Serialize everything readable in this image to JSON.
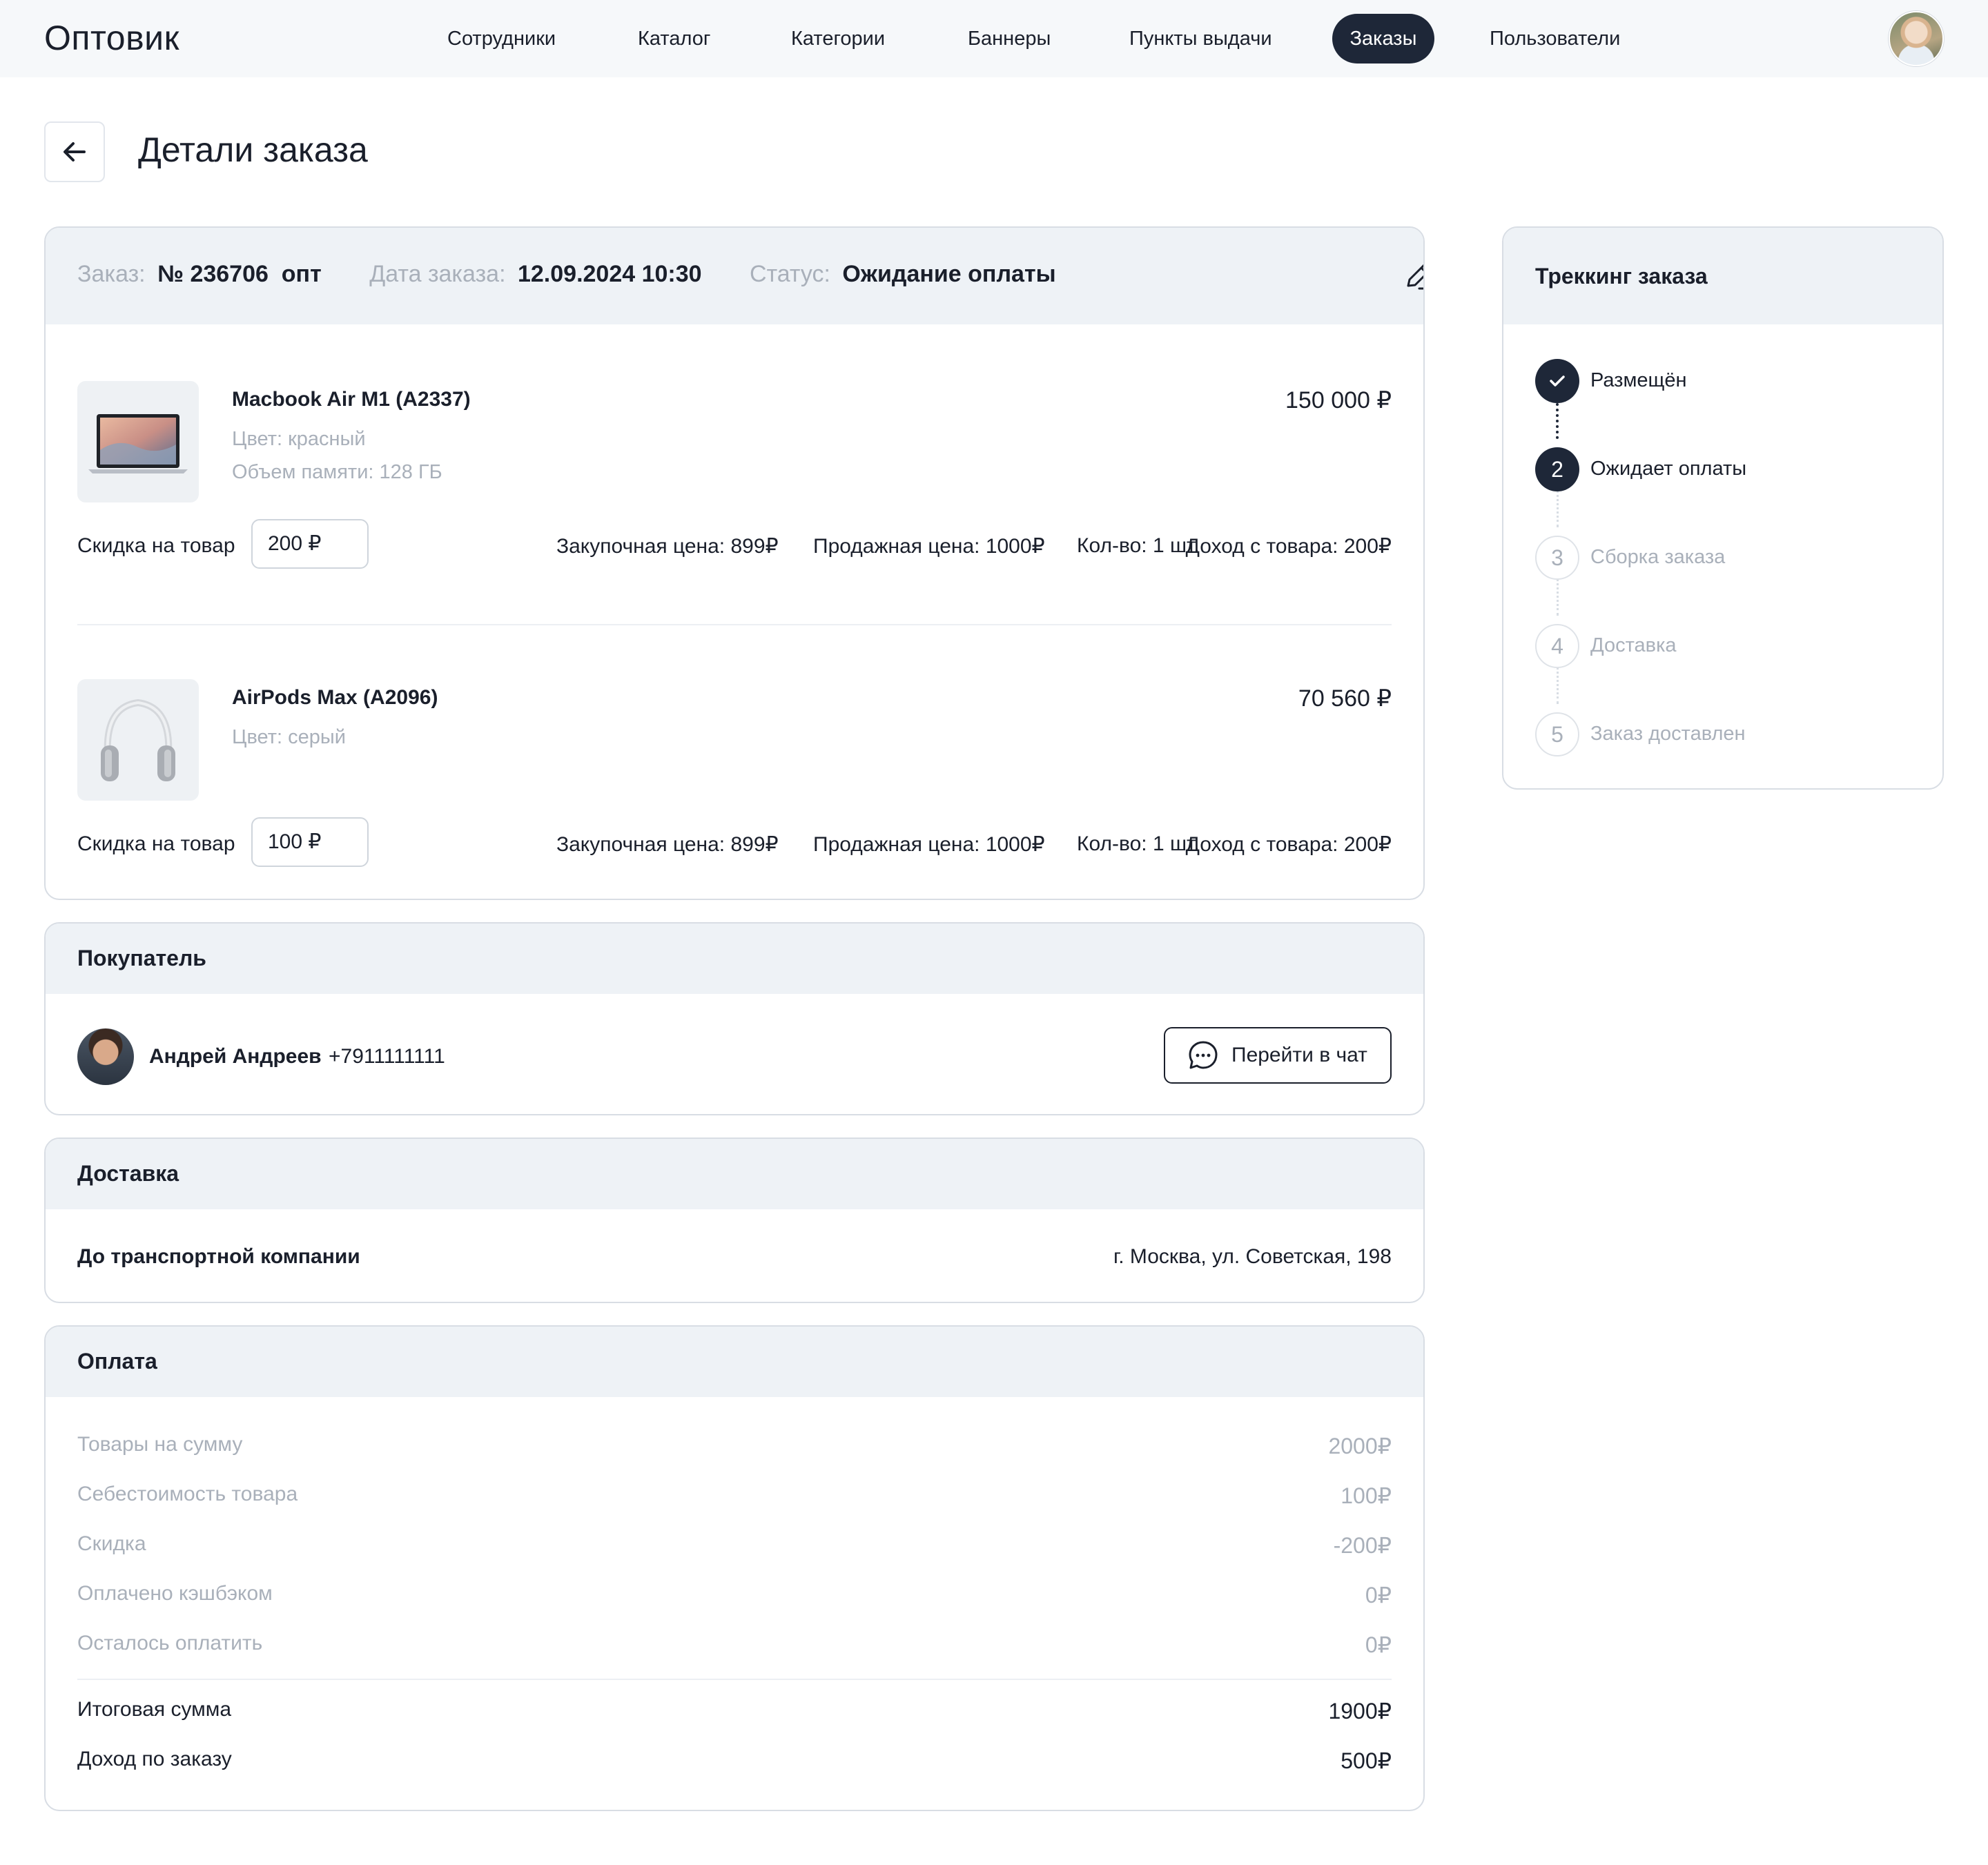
{
  "app": {
    "logo": "Оптовик",
    "nav": [
      {
        "label": "Сотрудники",
        "active": false
      },
      {
        "label": "Каталог",
        "active": false
      },
      {
        "label": "Категории",
        "active": false
      },
      {
        "label": "Баннеры",
        "active": false
      },
      {
        "label": "Пункты выдачи",
        "active": false
      },
      {
        "label": "Заказы",
        "active": true
      },
      {
        "label": "Пользователи",
        "active": false
      }
    ],
    "avatar_icon": "user-avatar"
  },
  "page": {
    "title": "Детали заказа",
    "back_icon": "arrow-left-icon"
  },
  "order": {
    "order_label": "Заказ:",
    "order_number": "№ 236706  опт",
    "date_label": "Дата заказа:",
    "date_value": "12.09.2024 10:30",
    "status_label": "Статус:",
    "status_value": "Ожидание оплаты",
    "edit_icon": "pencil-icon",
    "products": [
      {
        "name": "Macbook Air M1 (A2337)",
        "attrs": [
          "Цвет: красный",
          "Объем памяти: 128 ГБ"
        ],
        "price": "150 000 ₽",
        "discount_label": "Скидка на товар",
        "discount_value": "200 ₽",
        "purchase_price": "Закупочная цена: 899₽",
        "sale_price": "Продажная цена: 1000₽",
        "qty": "Кол-во: 1 шт.",
        "income": "Доход с товара: 200₽"
      },
      {
        "name": "AirPods Max (A2096)",
        "attrs": [
          "Цвет: серый"
        ],
        "price": "70 560 ₽",
        "discount_label": "Скидка на товар",
        "discount_value": "100 ₽",
        "purchase_price": "Закупочная цена: 899₽",
        "sale_price": "Продажная цена: 1000₽",
        "qty": "Кол-во: 1 шт.",
        "income": "Доход с товара: 200₽"
      }
    ]
  },
  "buyer": {
    "title": "Покупатель",
    "name": "Андрей Андреев",
    "phone": "+7911111111",
    "chat_button": "Перейти в чат",
    "chat_icon": "chat-bubble-icon"
  },
  "delivery": {
    "title": "Доставка",
    "method": "До транспортной компании",
    "address": "г. Москва, ул. Советская, 198"
  },
  "payment": {
    "title": "Оплата",
    "rows": [
      {
        "label": "Товары на сумму",
        "value": "2000₽"
      },
      {
        "label": "Себестоимость товара",
        "value": "100₽"
      },
      {
        "label": "Скидка",
        "value": "-200₽"
      },
      {
        "label": "Оплачено кэшбэком",
        "value": "0₽"
      },
      {
        "label": "Осталось оплатить",
        "value": "0₽"
      }
    ],
    "total_label": "Итоговая сумма",
    "total_value": "1900₽",
    "income_label": "Доход по заказу",
    "income_value": "500₽"
  },
  "tracking": {
    "title": "Треккинг заказа",
    "steps": [
      {
        "marker": "check-icon",
        "label": "Размещён",
        "state": "done"
      },
      {
        "marker": "2",
        "label": "Ожидает оплаты",
        "state": "current"
      },
      {
        "marker": "3",
        "label": "Сборка заказа",
        "state": "todo"
      },
      {
        "marker": "4",
        "label": "Доставка",
        "state": "todo"
      },
      {
        "marker": "5",
        "label": "Заказ доставлен",
        "state": "todo"
      }
    ]
  }
}
